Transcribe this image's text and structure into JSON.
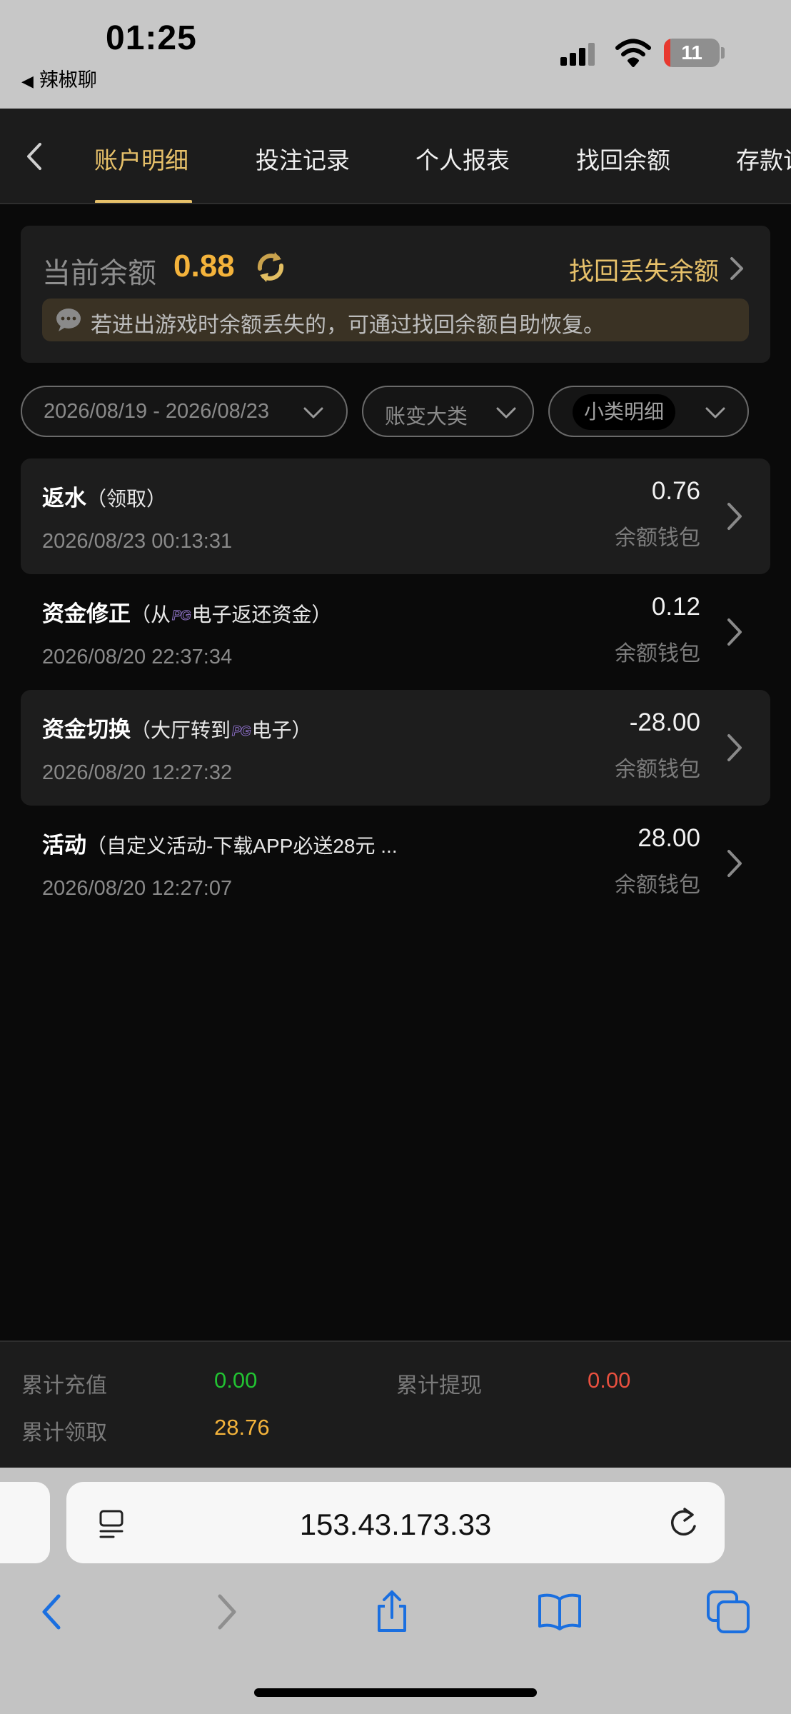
{
  "status_bar": {
    "time": "01:25",
    "back_app": "辣椒聊",
    "battery": "11"
  },
  "nav": {
    "tabs": [
      {
        "label": "账户明细",
        "active": true
      },
      {
        "label": "投注记录"
      },
      {
        "label": "个人报表"
      },
      {
        "label": "找回余额"
      },
      {
        "label": "存款记"
      }
    ]
  },
  "balance": {
    "label": "当前余额",
    "value": "0.88",
    "recover_link": "找回丢失余额",
    "notice": "若进出游戏时余额丢失的，可通过找回余额自助恢复。"
  },
  "filters": {
    "date_range": "2026/08/19 - 2026/08/23",
    "category": "账变大类",
    "subcategory": "小类明细"
  },
  "records": [
    {
      "title": "返水",
      "detail_pre": "（领取）",
      "detail_post": "",
      "time": "2026/08/23 00:13:31",
      "amount": "0.76",
      "wallet": "余额钱包"
    },
    {
      "title": "资金修正",
      "detail_pre": "（从",
      "detail_post": "电子返还资金）",
      "time": "2026/08/20 22:37:34",
      "amount": "0.12",
      "wallet": "余额钱包"
    },
    {
      "title": "资金切换",
      "detail_pre": "（大厅转到",
      "detail_post": "电子）",
      "time": "2026/08/20 12:27:32",
      "amount": "-28.00",
      "wallet": "余额钱包"
    },
    {
      "title": "活动",
      "detail_pre": "（自定义活动-下载APP必送28元 ...",
      "detail_post": "",
      "time": "2026/08/20 12:27:07",
      "amount": "28.00",
      "wallet": "余额钱包"
    }
  ],
  "summary": {
    "recharge_label": "累计充值",
    "recharge_value": "0.00",
    "withdraw_label": "累计提现",
    "withdraw_value": "0.00",
    "claim_label": "累计领取",
    "claim_value": "28.76"
  },
  "browser": {
    "url": "153.43.173.33"
  },
  "colors": {
    "gold": "#e7c16a",
    "orange": "#f4b33b",
    "green": "#22c232",
    "red": "#e8503f"
  }
}
